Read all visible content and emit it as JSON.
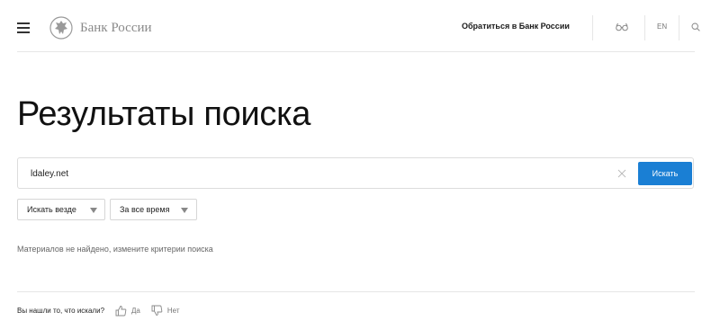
{
  "header": {
    "logo_text": "Банк России",
    "contact_link": "Обратиться в Банк России",
    "language": "EN",
    "icons": [
      "menu-icon",
      "bank-emblem-icon",
      "eye-icon",
      "search-icon"
    ]
  },
  "main": {
    "title": "Результаты поиска",
    "search": {
      "value": "ldaley.net",
      "placeholder": "",
      "button_label": "Искать"
    },
    "filters": [
      {
        "label": "Искать везде"
      },
      {
        "label": "За все время"
      }
    ],
    "no_results_text": "Материалов не найдено, измените критерии поиска"
  },
  "feedback": {
    "question": "Вы нашли то, что искали?",
    "yes_label": "Да",
    "no_label": "Нет"
  },
  "colors": {
    "accent": "#1a7fd4",
    "text": "#1a1a1a",
    "muted": "#8a8a8a",
    "divider": "#e6e6e6"
  }
}
